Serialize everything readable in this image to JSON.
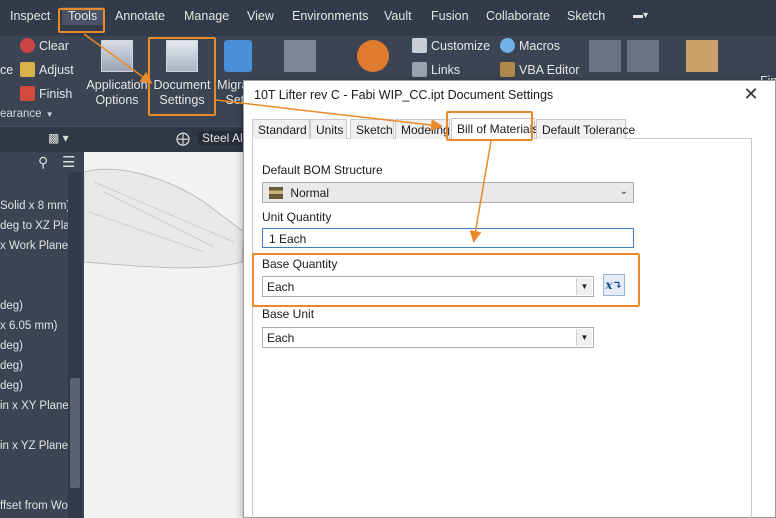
{
  "menu": [
    "Inspect",
    "Tools",
    "Annotate",
    "Manage",
    "View",
    "Environments",
    "Vault",
    "Fusion",
    "Collaborate",
    "Sketch"
  ],
  "ribbon": {
    "clear": "Clear",
    "adjust": "Adjust",
    "finish": "Finish",
    "appearance_partial": "earance",
    "ce_partial": "ce",
    "application_options_1": "Application",
    "application_options_2": "Options",
    "document_settings_1": "Document",
    "document_settings_2": "Settings",
    "migrate": "Migrate",
    "migrate_2": "Setti",
    "customize": "Customize",
    "links": "Links",
    "macros": "Macros",
    "vba_editor": "VBA Editor",
    "fin_partial": "Fin",
    "steel_partial": "Steel Al"
  },
  "browser": {
    "items": [
      "Solid x 8 mm)",
      "deg to XZ Plan",
      "x Work Plane5",
      "deg)",
      "x 6.05 mm)",
      "deg)",
      "deg)",
      "deg)",
      "in x XY Plane)",
      "in x YZ Plane)",
      "ffset from Wor"
    ]
  },
  "dialog": {
    "title": "10T Lifter rev C - Fabi WIP_CC.ipt Document Settings",
    "tabs": [
      "Standard",
      "Units",
      "Sketch",
      "Modeling",
      "Bill of Materials",
      "Default Tolerance"
    ],
    "active_tab": "Bill of Materials",
    "default_bom_structure_label": "Default BOM Structure",
    "default_bom_structure_value": "Normal",
    "unit_quantity_label": "Unit Quantity",
    "unit_quantity_value": "1 Each",
    "base_quantity_label": "Base Quantity",
    "base_quantity_value": "Each",
    "base_unit_label": "Base Unit",
    "base_unit_value": "Each"
  },
  "colors": {
    "highlight": "#e98a2a",
    "ribbon_bg": "#3b4453",
    "menubar_bg": "#333b49"
  }
}
